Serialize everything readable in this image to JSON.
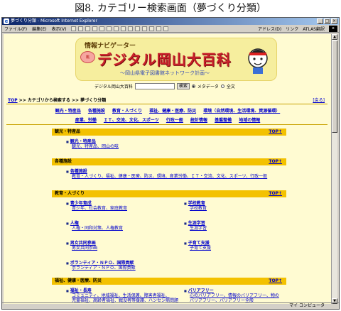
{
  "caption": "図8. カテゴリー検索画面（夢づくり分類）",
  "window": {
    "title": "夢づくり分類 - Microsoft Internet Explorer",
    "buttons": [
      "_",
      "□",
      "×"
    ]
  },
  "menu": {
    "items": [
      "ファイル(F)",
      "編集(E)",
      "表示(V)"
    ],
    "address_label": "アドレス(D)",
    "links_label": "リンク",
    "atlas_label": "ATLAS翻訳",
    "brand_badge": "e"
  },
  "banner": {
    "sub1": "情報ナビゲーター",
    "main": "デジタル岡山大百科",
    "sub2": "〜岡山県電子図書館ネットワーク計画〜",
    "peach_text": "桃"
  },
  "search": {
    "site_label": "デジタル岡山大百科",
    "input_value": "",
    "button_label": "検索",
    "option_meta": "メタデータ",
    "option_full": "全文",
    "selected": "meta"
  },
  "breadcrumb": {
    "top": "TOP",
    "sep1": " >> ",
    "category": "カテゴリから検索する",
    "sep2": " >> ",
    "current": "夢づくり分類"
  },
  "back_label": "[戻る]",
  "nav": {
    "row1": [
      "観光・特産品",
      "各種施設",
      "教育・人づくり",
      "福祉、健康・医療、防災",
      "環境（自然環境、生活環境、資源循環）"
    ],
    "row2": [
      "産業、労働",
      "ＩＴ、交流、文化、スポーツ",
      "行政一般",
      "統計情報",
      "基盤整備",
      "地域の情報"
    ]
  },
  "top_link": "TOP↑",
  "sections": [
    {
      "title": "観光・特産品",
      "items": [
        {
          "title": "観光・特産品",
          "subs": [
            "観光、特産品、岡山の味"
          ]
        }
      ]
    },
    {
      "title": "各種施設",
      "items": [
        {
          "title": "各種施設",
          "subs": [
            "教育・人づくり、福祉、健康・医療、防災、環境、産業労働、ＩＴ・交流、文化、スポーツ、行政一般"
          ]
        }
      ]
    },
    {
      "title": "教育・人づくり",
      "items": [
        {
          "title": "青少年育成",
          "subs": [
            "青少年、社会教育、家庭教育"
          ]
        },
        {
          "title": "学校教育",
          "subs": [
            "学校教育"
          ]
        },
        {
          "title": "人権",
          "subs": [
            "人権・同和対策、人権教育"
          ]
        },
        {
          "title": "生涯学習",
          "subs": [
            "生涯学習"
          ]
        },
        {
          "title": "男女共同参画",
          "subs": [
            "男女共同参画"
          ]
        },
        {
          "title": "子育て支援",
          "subs": [
            "子育て支援"
          ]
        },
        {
          "title": "ボランティア・ＮＰＯ、国際貢献",
          "subs": [
            "ボランティア・ＮＰＯ、国際貢献"
          ]
        }
      ]
    },
    {
      "title": "福祉、健康・医療、防災",
      "items": [
        {
          "title": "福祉・長寿",
          "subs": [
            "コミュニティ、地域福祉、生活保護、障害者福祉、",
            "児童福祉、高齢者福祉、戦没者等援護、ハンセン病問題"
          ]
        },
        {
          "title": "バリアフリー",
          "subs": [
            "心のバリアフリー、情報のバリアフリー、物の",
            "バリアフリー、バリアフリー全般"
          ]
        }
      ]
    }
  ],
  "status": {
    "text": "",
    "zone": "マイ コンピュータ"
  }
}
